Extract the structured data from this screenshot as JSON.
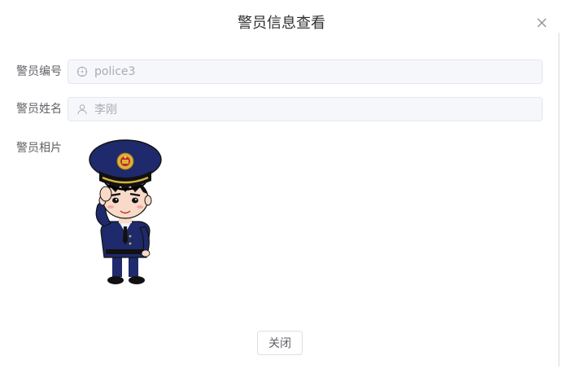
{
  "dialog": {
    "title": "警员信息查看",
    "close_icon": "close-icon"
  },
  "form": {
    "police_number": {
      "label": "警员编号",
      "value": "police3",
      "icon": "compass-icon"
    },
    "police_name": {
      "label": "警员姓名",
      "value": "李刚",
      "icon": "user-icon"
    },
    "police_photo": {
      "label": "警员相片"
    }
  },
  "footer": {
    "close_label": "关闭"
  },
  "colors": {
    "input_bg": "#f5f7fa",
    "input_border": "#e4e7ed",
    "text": "#606266",
    "placeholder": "#a8abb2",
    "uniform_navy": "#1e2a6b"
  }
}
